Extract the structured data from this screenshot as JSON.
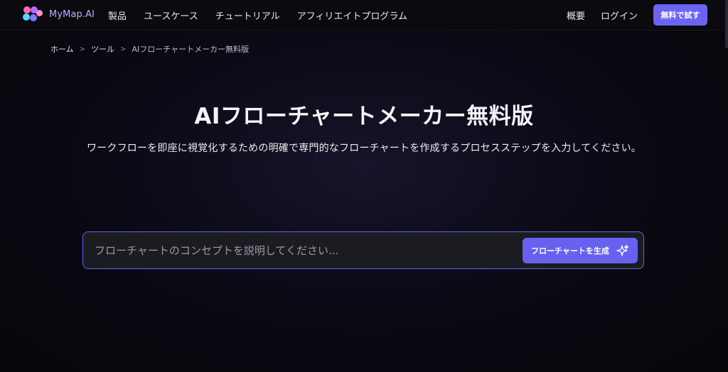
{
  "brand": {
    "name": "MyMap.AI",
    "colors": {
      "accent": "#6b63f2",
      "logo_dots": [
        "#ff6bb3",
        "#7a7cff",
        "#5fd3ff",
        "#b46cff"
      ]
    }
  },
  "nav": {
    "links": [
      "製品",
      "ユースケース",
      "チュートリアル",
      "アフィリエイトプログラム"
    ],
    "overview": "概要",
    "login": "ログイン",
    "trial_button": "無料で試す"
  },
  "breadcrumb": {
    "home": "ホーム",
    "tools": "ツール",
    "current": "AIフローチャートメーカー無料版",
    "separator": ">"
  },
  "hero": {
    "title": "AIフローチャートメーカー無料版",
    "subtitle": "ワークフローを即座に視覚化するための明確で専門的なフローチャートを作成するプロセスステップを入力してください。"
  },
  "prompt": {
    "placeholder": "フローチャートのコンセプトを説明してください...",
    "value": "",
    "generate_button": "フローチャートを生成",
    "generate_icon": "sparkle-icon"
  }
}
